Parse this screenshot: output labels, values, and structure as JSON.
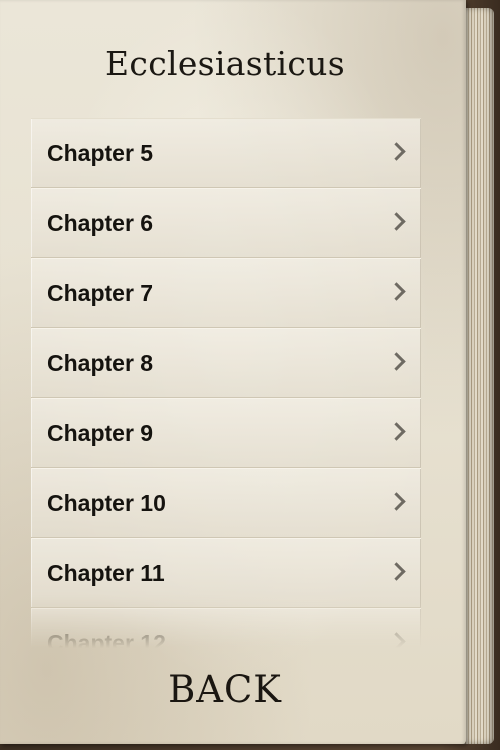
{
  "header": {
    "title": "Ecclesiasticus"
  },
  "chapters": [
    {
      "label": "Chapter 5"
    },
    {
      "label": "Chapter 6"
    },
    {
      "label": "Chapter 7"
    },
    {
      "label": "Chapter 8"
    },
    {
      "label": "Chapter 9"
    },
    {
      "label": "Chapter 10"
    },
    {
      "label": "Chapter 11"
    },
    {
      "label": "Chapter 12"
    }
  ],
  "footer": {
    "back_label": "BACK"
  },
  "icons": {
    "row_disclosure": "chevron-right-icon"
  }
}
